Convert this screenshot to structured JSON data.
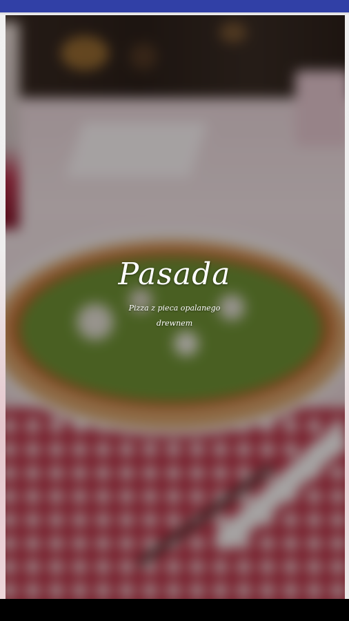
{
  "app": {
    "brand_name": "Pasada",
    "tagline": "Pizza z pieca opalanego drewnem"
  },
  "colors": {
    "status_bar": "#3140a6",
    "text": "#ffffff",
    "navigation_bar": "#000000"
  }
}
